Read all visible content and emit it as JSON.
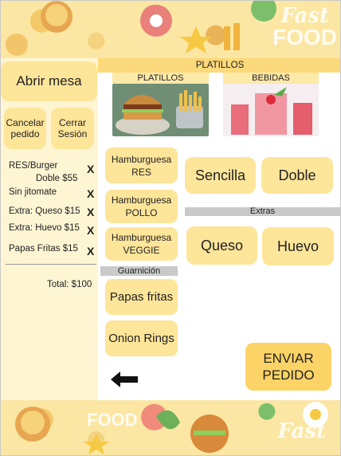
{
  "banner": {
    "fast": "Fast",
    "food": "FOOD"
  },
  "left": {
    "abrir_label": "Abrir mesa",
    "cancel_label": "Cancelar pedido",
    "cerrar_label": "Cerrar Sesión",
    "order_lines": [
      {
        "text": "RES/Burger",
        "remove": "X"
      },
      {
        "text": "Doble $55"
      },
      {
        "text": "Sin jitomate",
        "remove": "X"
      },
      {
        "text": "Extra: Queso $15",
        "remove": "X"
      },
      {
        "text": "Extra: Huevo $15",
        "remove": "X"
      },
      {
        "text": "Papas Fritas $15",
        "remove": "X"
      }
    ],
    "total": "Total: $100"
  },
  "main": {
    "section_title": "PLATILLOS",
    "categories": [
      "PLATILLOS",
      "BEBIDAS"
    ],
    "items": [
      "Hamburguesa RES",
      "Hamburguesa POLLO",
      "Hamburguesa VEGGIE"
    ],
    "guarnicion_title": "Guarnición",
    "sides": [
      "Papas fritas",
      "Onion Rings"
    ],
    "sizes": [
      "Sencilla",
      "Doble"
    ],
    "extras_title": "Extras",
    "extras": [
      "Queso",
      "Huevo"
    ],
    "send_label": "ENVIAR PEDIDO"
  },
  "icons": {
    "back": "back-arrow-icon"
  }
}
